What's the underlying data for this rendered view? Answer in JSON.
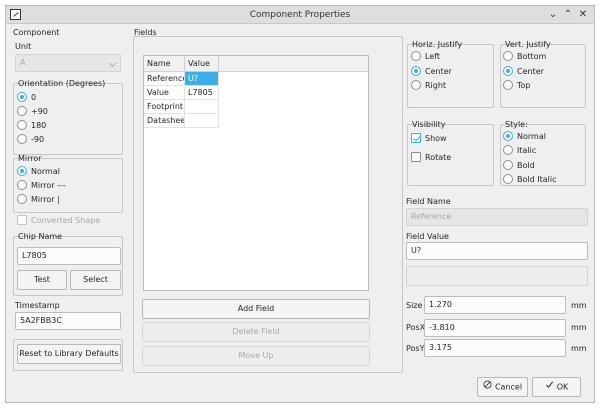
{
  "window": {
    "title": "Component Properties"
  },
  "left": {
    "section_label": "Component",
    "unit": {
      "label": "Unit",
      "value": "A"
    },
    "orientation": {
      "label": "Orientation (Degrees)",
      "options": [
        "0",
        "+90",
        "180",
        "-90"
      ],
      "selected": "0"
    },
    "mirror": {
      "label": "Mirror",
      "options": [
        "Normal",
        "Mirror ---",
        "Mirror |"
      ],
      "selected": "Normal"
    },
    "converted_shape": {
      "label": "Converted Shape"
    },
    "chip_name": {
      "label": "Chip Name",
      "value": "L7805",
      "test_label": "Test",
      "select_label": "Select"
    },
    "timestamp": {
      "label": "Timestamp",
      "value": "5A2FBB3C"
    },
    "reset_label": "Reset to Library Defaults"
  },
  "fields": {
    "section_label": "Fields",
    "columns": [
      "Name",
      "Value"
    ],
    "rows": [
      {
        "name": "Reference",
        "value": "U?"
      },
      {
        "name": "Value",
        "value": "L7805"
      },
      {
        "name": "Footprint",
        "value": ""
      },
      {
        "name": "Datasheet",
        "value": ""
      }
    ],
    "add_label": "Add Field",
    "delete_label": "Delete Field",
    "moveup_label": "Move Up"
  },
  "right": {
    "horiz": {
      "label": "Horiz. Justify",
      "options": [
        "Left",
        "Center",
        "Right"
      ],
      "selected": "Center"
    },
    "vert": {
      "label": "Vert. Justify",
      "options": [
        "Bottom",
        "Center",
        "Top"
      ],
      "selected": "Center"
    },
    "visibility": {
      "label": "Visibility",
      "show_label": "Show",
      "rotate_label": "Rotate"
    },
    "style": {
      "label": "Style:",
      "options": [
        "Normal",
        "Italic",
        "Bold",
        "Bold Italic"
      ],
      "selected": "Normal"
    },
    "field_name": {
      "label": "Field Name",
      "value": "Reference"
    },
    "field_value": {
      "label": "Field Value",
      "value": "U?"
    },
    "size": {
      "label": "Size",
      "value": "1.270",
      "unit": "mm"
    },
    "posx": {
      "label": "PosX",
      "value": "-3.810",
      "unit": "mm"
    },
    "posy": {
      "label": "PosY",
      "value": "3.175",
      "unit": "mm"
    }
  },
  "footer": {
    "cancel_label": "Cancel",
    "ok_label": "OK"
  },
  "colors": {
    "accent": "#3daee9",
    "window_bg": "#efefef",
    "titlebar_bg": "#dedede"
  }
}
